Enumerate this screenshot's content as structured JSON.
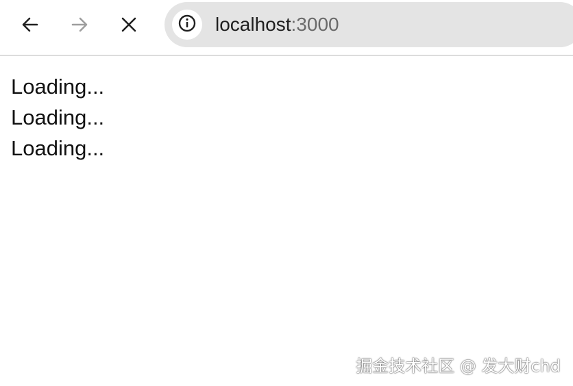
{
  "toolbar": {
    "back_icon": "arrow-left-icon",
    "forward_icon": "arrow-right-icon",
    "stop_icon": "close-icon",
    "site_info_icon": "info-icon",
    "url_host": "localhost",
    "url_port": ":3000"
  },
  "page": {
    "lines": [
      "Loading...",
      "Loading...",
      "Loading..."
    ]
  },
  "watermark": "掘金技术社区 @ 发大财chd",
  "colors": {
    "omnibox_bg": "#e4e4e4",
    "text": "#111111",
    "disabled_icon": "#9e9e9e"
  }
}
